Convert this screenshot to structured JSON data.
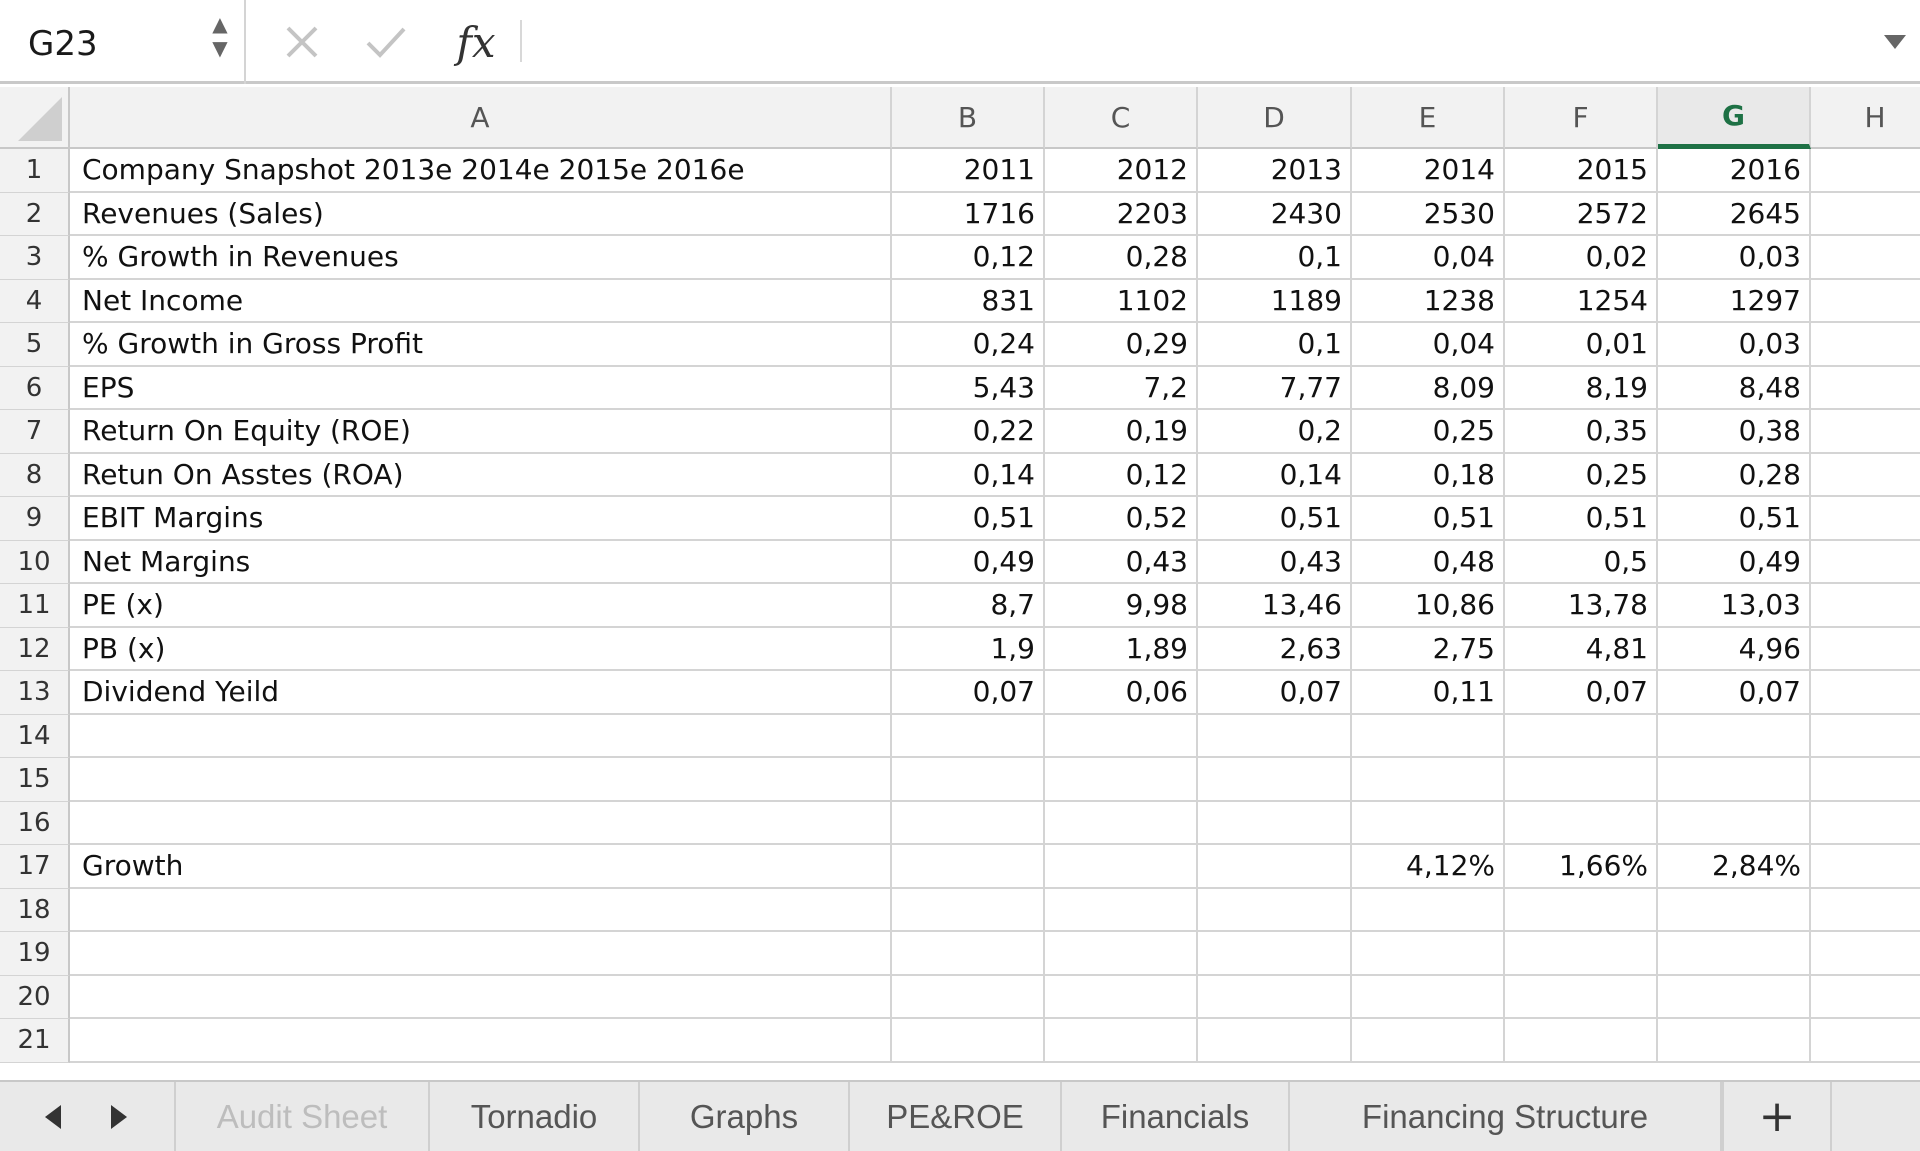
{
  "formula_bar": {
    "name_box": "G23",
    "fx_label": "fx",
    "formula": ""
  },
  "columns": [
    "A",
    "B",
    "C",
    "D",
    "E",
    "F",
    "G",
    "H"
  ],
  "selected_column": "G",
  "selected_cell": "G23",
  "row_numbers": [
    "1",
    "2",
    "3",
    "4",
    "5",
    "6",
    "7",
    "8",
    "9",
    "10",
    "11",
    "12",
    "13",
    "14",
    "15",
    "16",
    "17",
    "18",
    "19",
    "20",
    "21"
  ],
  "rows": [
    [
      "Company Snapshot   2013e 2014e 2015e 2016e",
      "2011",
      "2012",
      "2013",
      "2014",
      "2015",
      "2016",
      ""
    ],
    [
      "Revenues (Sales)",
      "1716",
      "2203",
      "2430",
      "2530",
      "2572",
      "2645",
      ""
    ],
    [
      "% Growth in Revenues",
      "0,12",
      "0,28",
      "0,1",
      "0,04",
      "0,02",
      "0,03",
      ""
    ],
    [
      "Net Income",
      "831",
      "1102",
      "1189",
      "1238",
      "1254",
      "1297",
      ""
    ],
    [
      "% Growth in Gross Profit",
      "0,24",
      "0,29",
      "0,1",
      "0,04",
      "0,01",
      "0,03",
      ""
    ],
    [
      "EPS",
      "5,43",
      "7,2",
      "7,77",
      "8,09",
      "8,19",
      "8,48",
      ""
    ],
    [
      "Return On Equity (ROE)",
      "0,22",
      "0,19",
      "0,2",
      "0,25",
      "0,35",
      "0,38",
      ""
    ],
    [
      "Retun On Asstes (ROA)",
      "0,14",
      "0,12",
      "0,14",
      "0,18",
      "0,25",
      "0,28",
      ""
    ],
    [
      "EBIT Margins",
      "0,51",
      "0,52",
      "0,51",
      "0,51",
      "0,51",
      "0,51",
      ""
    ],
    [
      "Net Margins",
      "0,49",
      "0,43",
      "0,43",
      "0,48",
      "0,5",
      "0,49",
      ""
    ],
    [
      "PE (x)",
      "8,7",
      "9,98",
      "13,46",
      "10,86",
      "13,78",
      "13,03",
      ""
    ],
    [
      "PB (x)",
      "1,9",
      "1,89",
      "2,63",
      "2,75",
      "4,81",
      "4,96",
      ""
    ],
    [
      "Dividend Yeild",
      "0,07",
      "0,06",
      "0,07",
      "0,11",
      "0,07",
      "0,07",
      ""
    ],
    [
      "",
      "",
      "",
      "",
      "",
      "",
      "",
      ""
    ],
    [
      "",
      "",
      "",
      "",
      "",
      "",
      "",
      ""
    ],
    [
      "",
      "",
      "",
      "",
      "",
      "",
      "",
      ""
    ],
    [
      "Growth",
      "",
      "",
      "",
      "4,12%",
      "1,66%",
      "2,84%",
      ""
    ],
    [
      "",
      "",
      "",
      "",
      "",
      "",
      "",
      ""
    ],
    [
      "",
      "",
      "",
      "",
      "",
      "",
      "",
      ""
    ],
    [
      "",
      "",
      "",
      "",
      "",
      "",
      "",
      ""
    ],
    [
      "",
      "",
      "",
      "",
      "",
      "",
      "",
      ""
    ]
  ],
  "sheet_tabs": [
    "Audit Sheet",
    "Tornadio",
    "Graphs",
    "PE&ROE",
    "Financials",
    "Financing Structure"
  ],
  "add_sheet_label": "+",
  "colors": {
    "accent": "#1e7145",
    "header_bg": "#f2f2f2",
    "gridline": "#d4d4d4"
  },
  "icons": {
    "cancel": "x-icon",
    "confirm": "check-icon",
    "prev_sheet": "triangle-left-icon",
    "next_sheet": "triangle-right-icon"
  }
}
